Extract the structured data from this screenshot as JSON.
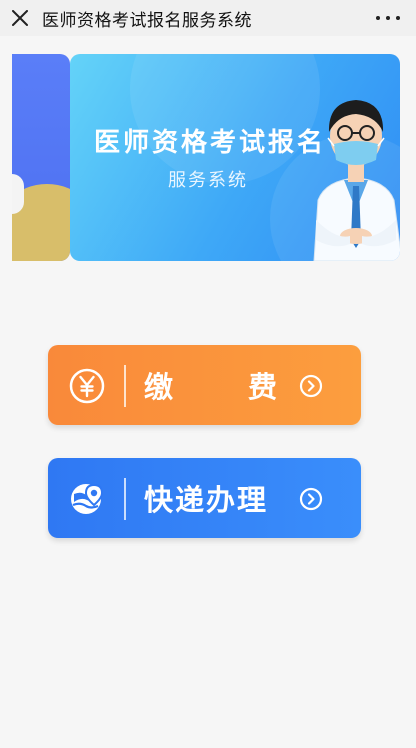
{
  "window": {
    "title": "医师资格考试报名服务系统",
    "close_icon": "close-icon",
    "more_icon": "more-icon"
  },
  "banner": {
    "title": "医师资格考试报名",
    "subtitle": "服务系统"
  },
  "actions": {
    "pay": {
      "label_first": "缴",
      "label_second": "费",
      "icon": "yen-icon"
    },
    "express": {
      "label": "快递办理",
      "icon": "globe-location-icon"
    }
  },
  "colors": {
    "pay_orange": "#f9893a",
    "express_blue": "#2f78f3",
    "banner_blue": "#3ea8f7"
  }
}
